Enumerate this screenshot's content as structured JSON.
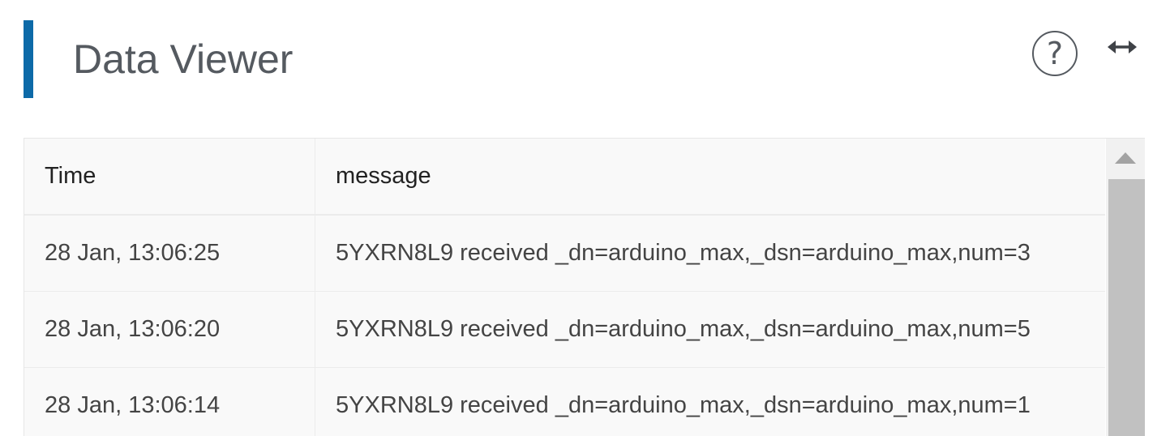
{
  "header": {
    "title": "Data Viewer",
    "help_icon": "question-circle-icon",
    "help_glyph": "?",
    "expand_icon": "horizontal-resize-arrows-icon",
    "accent_color": "#0d6aa8"
  },
  "table": {
    "columns": [
      "Time",
      "message"
    ],
    "rows": [
      {
        "time": "28 Jan, 13:06:25",
        "message": "5YXRN8L9 received _dn=arduino_max,_dsn=arduino_max,num=3"
      },
      {
        "time": "28 Jan, 13:06:20",
        "message": "5YXRN8L9 received _dn=arduino_max,_dsn=arduino_max,num=5"
      },
      {
        "time": "28 Jan, 13:06:14",
        "message": "5YXRN8L9 received _dn=arduino_max,_dsn=arduino_max,num=1"
      }
    ]
  },
  "scrollbar": {
    "up_icon": "triangle-up-icon"
  }
}
